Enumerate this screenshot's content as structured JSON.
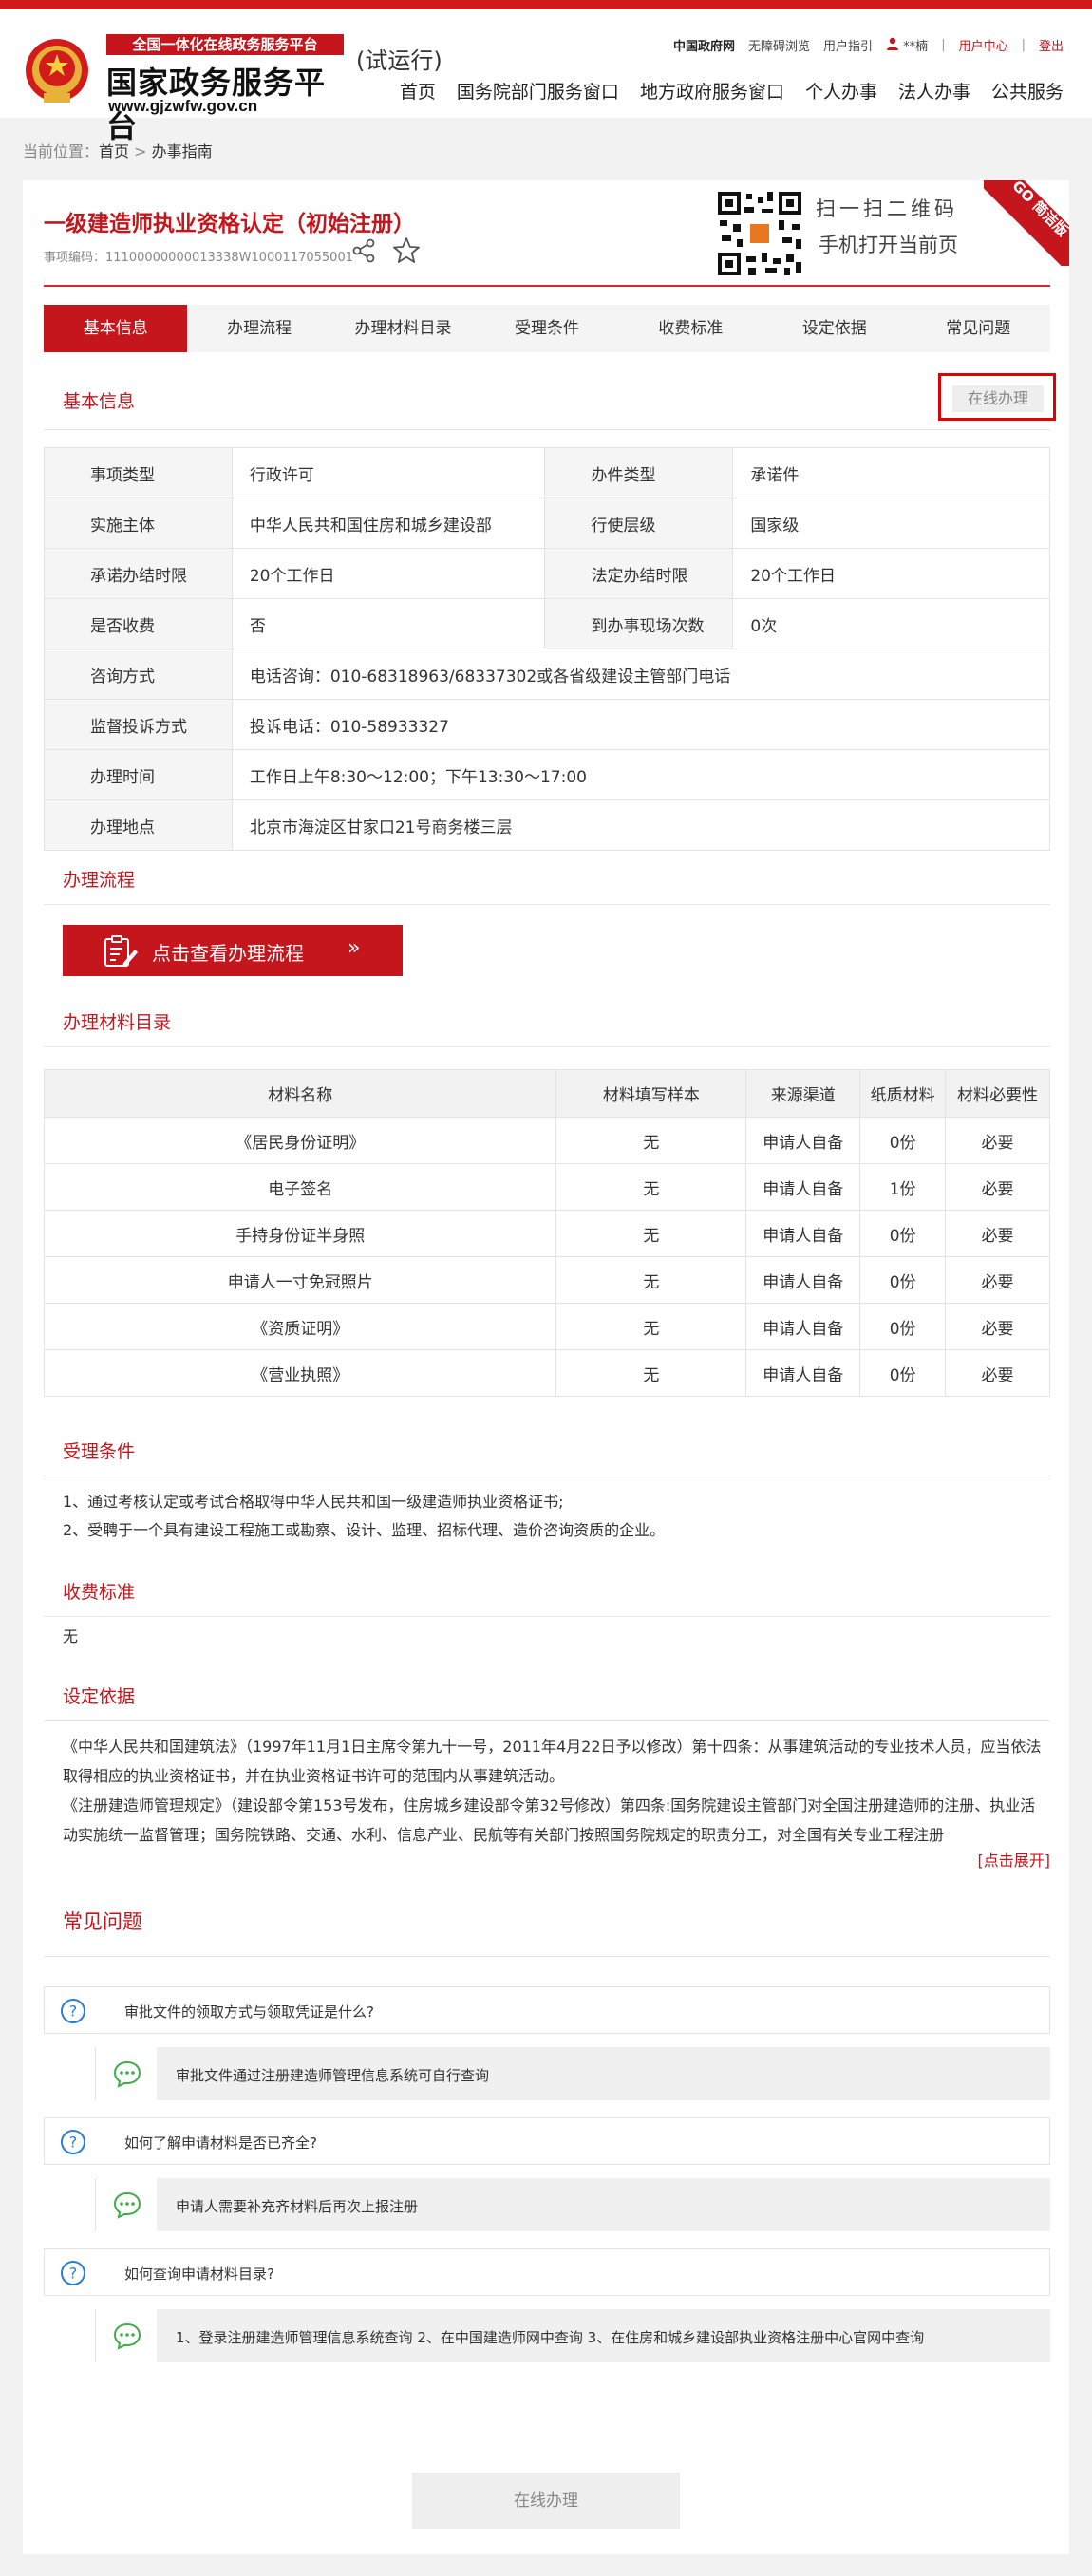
{
  "header": {
    "banner": "全国一体化在线政务服务平台",
    "site_title": "国家政务服务平台",
    "site_url": "www.gjzwfw.gov.cn",
    "trial": "(试运行)",
    "toplinks": {
      "gov": "中国政府网",
      "accessible": "无障碍浏览",
      "guide": "用户指引",
      "user": "**楠",
      "sep1": "|",
      "center": "用户中心",
      "sep2": "|",
      "logout": "登出"
    },
    "nav": [
      "首页",
      "国务院部门服务窗口",
      "地方政府服务窗口",
      "个人办事",
      "法人办事",
      "公共服务"
    ]
  },
  "breadcrumb": {
    "prefix": "当前位置：",
    "home": "首页",
    "arrow": " > ",
    "current": "办事指南"
  },
  "item": {
    "title": "一级建造师执业资格认定（初始注册）",
    "code": "事项编码：11100000000013338W1000117055001",
    "ribbon": "GO 简洁版",
    "scan_line1": "扫一扫二维码",
    "scan_line2": "手机打开当前页"
  },
  "tabs": [
    "基本信息",
    "办理流程",
    "办理材料目录",
    "受理条件",
    "收费标准",
    "设定依据",
    "常见问题"
  ],
  "basic": {
    "section": "基本信息",
    "online_button": "在线办理",
    "rows": [
      {
        "l1": "事项类型",
        "v1": "行政许可",
        "l2": "办件类型",
        "v2": "承诺件"
      },
      {
        "l1": "实施主体",
        "v1": "中华人民共和国住房和城乡建设部",
        "l2": "行使层级",
        "v2": "国家级"
      },
      {
        "l1": "承诺办结时限",
        "v1": "20个工作日",
        "l2": "法定办结时限",
        "v2": "20个工作日"
      },
      {
        "l1": "是否收费",
        "v1": "否",
        "l2": "到办事现场次数",
        "v2": "0次"
      }
    ],
    "wide_rows": [
      {
        "l": "咨询方式",
        "v": "电话咨询：010-68318963/68337302或各省级建设主管部门电话"
      },
      {
        "l": "监督投诉方式",
        "v": "投诉电话：010-58933327"
      },
      {
        "l": "办理时间",
        "v": "工作日上午8:30～12:00；下午13:30～17:00"
      },
      {
        "l": "办理地点",
        "v": "北京市海淀区甘家口21号商务楼三层"
      }
    ]
  },
  "process": {
    "section": "办理流程",
    "button": "点击查看办理流程",
    "arrow": "»"
  },
  "materials": {
    "section": "办理材料目录",
    "headers": [
      "材料名称",
      "材料填写样本",
      "来源渠道",
      "纸质材料",
      "材料必要性"
    ],
    "rows": [
      [
        "《居民身份证明》",
        "无",
        "申请人自备",
        "0份",
        "必要"
      ],
      [
        "电子签名",
        "无",
        "申请人自备",
        "1份",
        "必要"
      ],
      [
        "手持身份证半身照",
        "无",
        "申请人自备",
        "0份",
        "必要"
      ],
      [
        "申请人一寸免冠照片",
        "无",
        "申请人自备",
        "0份",
        "必要"
      ],
      [
        "《资质证明》",
        "无",
        "申请人自备",
        "0份",
        "必要"
      ],
      [
        "《营业执照》",
        "无",
        "申请人自备",
        "0份",
        "必要"
      ]
    ]
  },
  "conditions": {
    "section": "受理条件",
    "lines": [
      "1、通过考核认定或考试合格取得中华人民共和国一级建造师执业资格证书;",
      "2、受聘于一个具有建设工程施工或勘察、设计、监理、招标代理、造价咨询资质的企业。"
    ]
  },
  "fees": {
    "section": "收费标准",
    "text": "无"
  },
  "basis": {
    "section": "设定依据",
    "p1": "《中华人民共和国建筑法》（1997年11月1日主席令第九十一号，2011年4月22日予以修改）第十四条：从事建筑活动的专业技术人员，应当依法取得相应的执业资格证书，并在执业资格证书许可的范围内从事建筑活动。",
    "p2": "《注册建造师管理规定》（建设部令第153号发布，住房城乡建设部令第32号修改）第四条:国务院建设主管部门对全国注册建造师的注册、执业活动实施统一监督管理；国务院铁路、交通、水利、信息产业、民航等有关部门按照国务院规定的职责分工，对全国有关专业工程注册",
    "expand": "[点击展开]"
  },
  "faq": {
    "section": "常见问题",
    "items": [
      {
        "q": "审批文件的领取方式与领取凭证是什么?",
        "a": "审批文件通过注册建造师管理信息系统可自行查询"
      },
      {
        "q": "如何了解申请材料是否已齐全?",
        "a": "申请人需要补充齐材料后再次上报注册"
      },
      {
        "q": "如何查询申请材料目录?",
        "a": "1、登录注册建造师管理信息系统查询 2、在中国建造师网中查询 3、在住房和城乡建设部执业资格注册中心官网中查询"
      }
    ]
  },
  "bottom_button": "在线办理"
}
